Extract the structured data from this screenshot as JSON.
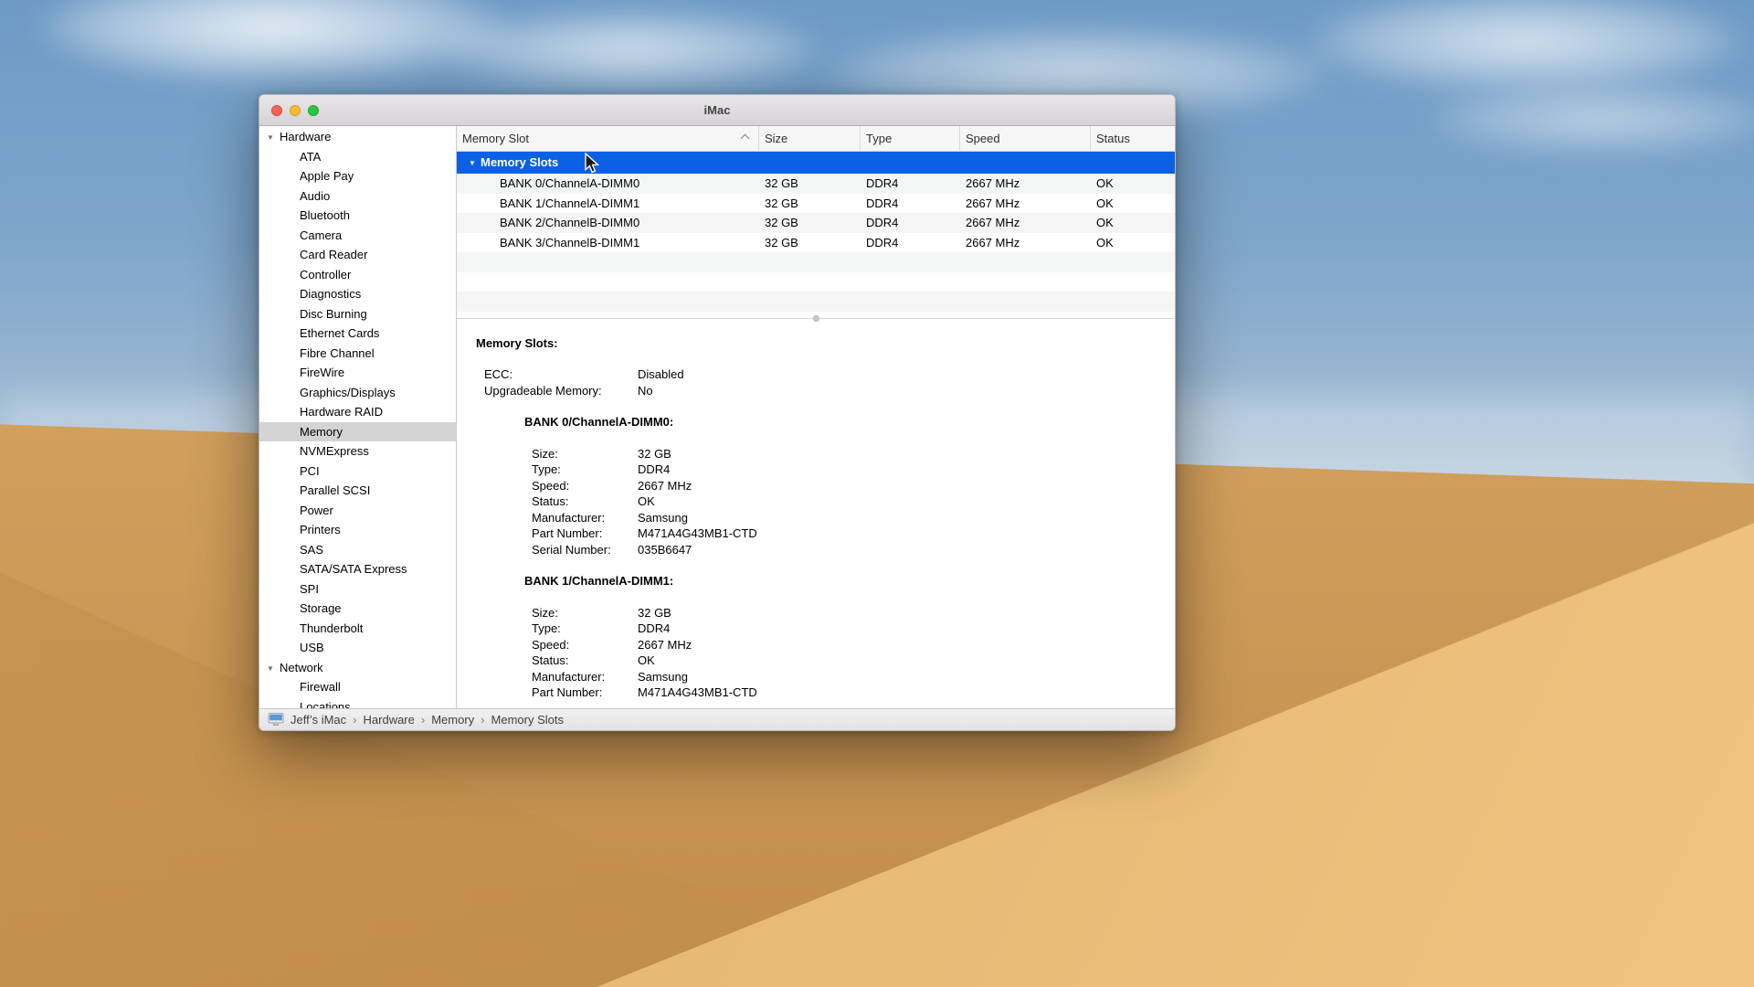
{
  "window": {
    "title": "iMac"
  },
  "colors": {
    "selection_blue": "#0b61e4",
    "traffic_close": "#ff5f57",
    "traffic_minimize": "#febc2e",
    "traffic_zoom": "#28c840"
  },
  "sidebar": {
    "selected_item": "Memory",
    "sections": [
      {
        "label": "Hardware",
        "items": [
          "ATA",
          "Apple Pay",
          "Audio",
          "Bluetooth",
          "Camera",
          "Card Reader",
          "Controller",
          "Diagnostics",
          "Disc Burning",
          "Ethernet Cards",
          "Fibre Channel",
          "FireWire",
          "Graphics/Displays",
          "Hardware RAID",
          "Memory",
          "NVMExpress",
          "PCI",
          "Parallel SCSI",
          "Power",
          "Printers",
          "SAS",
          "SATA/SATA Express",
          "SPI",
          "Storage",
          "Thunderbolt",
          "USB"
        ]
      },
      {
        "label": "Network",
        "items": [
          "Firewall",
          "Locations"
        ]
      }
    ]
  },
  "table": {
    "columns": [
      "Memory Slot",
      "Size",
      "Type",
      "Speed",
      "Status"
    ],
    "sort": {
      "column": "Memory Slot",
      "direction": "ascending"
    },
    "group_row": {
      "label": "Memory Slots",
      "selected": true
    },
    "rows": [
      {
        "slot": "BANK 0/ChannelA-DIMM0",
        "size": "32 GB",
        "type": "DDR4",
        "speed": "2667 MHz",
        "status": "OK"
      },
      {
        "slot": "BANK 1/ChannelA-DIMM1",
        "size": "32 GB",
        "type": "DDR4",
        "speed": "2667 MHz",
        "status": "OK"
      },
      {
        "slot": "BANK 2/ChannelB-DIMM0",
        "size": "32 GB",
        "type": "DDR4",
        "speed": "2667 MHz",
        "status": "OK"
      },
      {
        "slot": "BANK 3/ChannelB-DIMM1",
        "size": "32 GB",
        "type": "DDR4",
        "speed": "2667 MHz",
        "status": "OK"
      }
    ]
  },
  "details": {
    "heading": "Memory Slots:",
    "global_fields": [
      {
        "label": "ECC:",
        "value": "Disabled"
      },
      {
        "label": "Upgradeable Memory:",
        "value": "No"
      }
    ],
    "banks": [
      {
        "heading": "BANK 0/ChannelA-DIMM0:",
        "fields": [
          {
            "label": "Size:",
            "value": "32 GB"
          },
          {
            "label": "Type:",
            "value": "DDR4"
          },
          {
            "label": "Speed:",
            "value": "2667 MHz"
          },
          {
            "label": "Status:",
            "value": "OK"
          },
          {
            "label": "Manufacturer:",
            "value": "Samsung"
          },
          {
            "label": "Part Number:",
            "value": "M471A4G43MB1-CTD"
          },
          {
            "label": "Serial Number:",
            "value": "035B6647"
          }
        ]
      },
      {
        "heading": "BANK 1/ChannelA-DIMM1:",
        "fields": [
          {
            "label": "Size:",
            "value": "32 GB"
          },
          {
            "label": "Type:",
            "value": "DDR4"
          },
          {
            "label": "Speed:",
            "value": "2667 MHz"
          },
          {
            "label": "Status:",
            "value": "OK"
          },
          {
            "label": "Manufacturer:",
            "value": "Samsung"
          },
          {
            "label": "Part Number:",
            "value": "M471A4G43MB1-CTD"
          }
        ]
      }
    ]
  },
  "statusbar": {
    "separator": "›",
    "items": [
      "Jeff’s iMac",
      "Hardware",
      "Memory",
      "Memory Slots"
    ]
  }
}
